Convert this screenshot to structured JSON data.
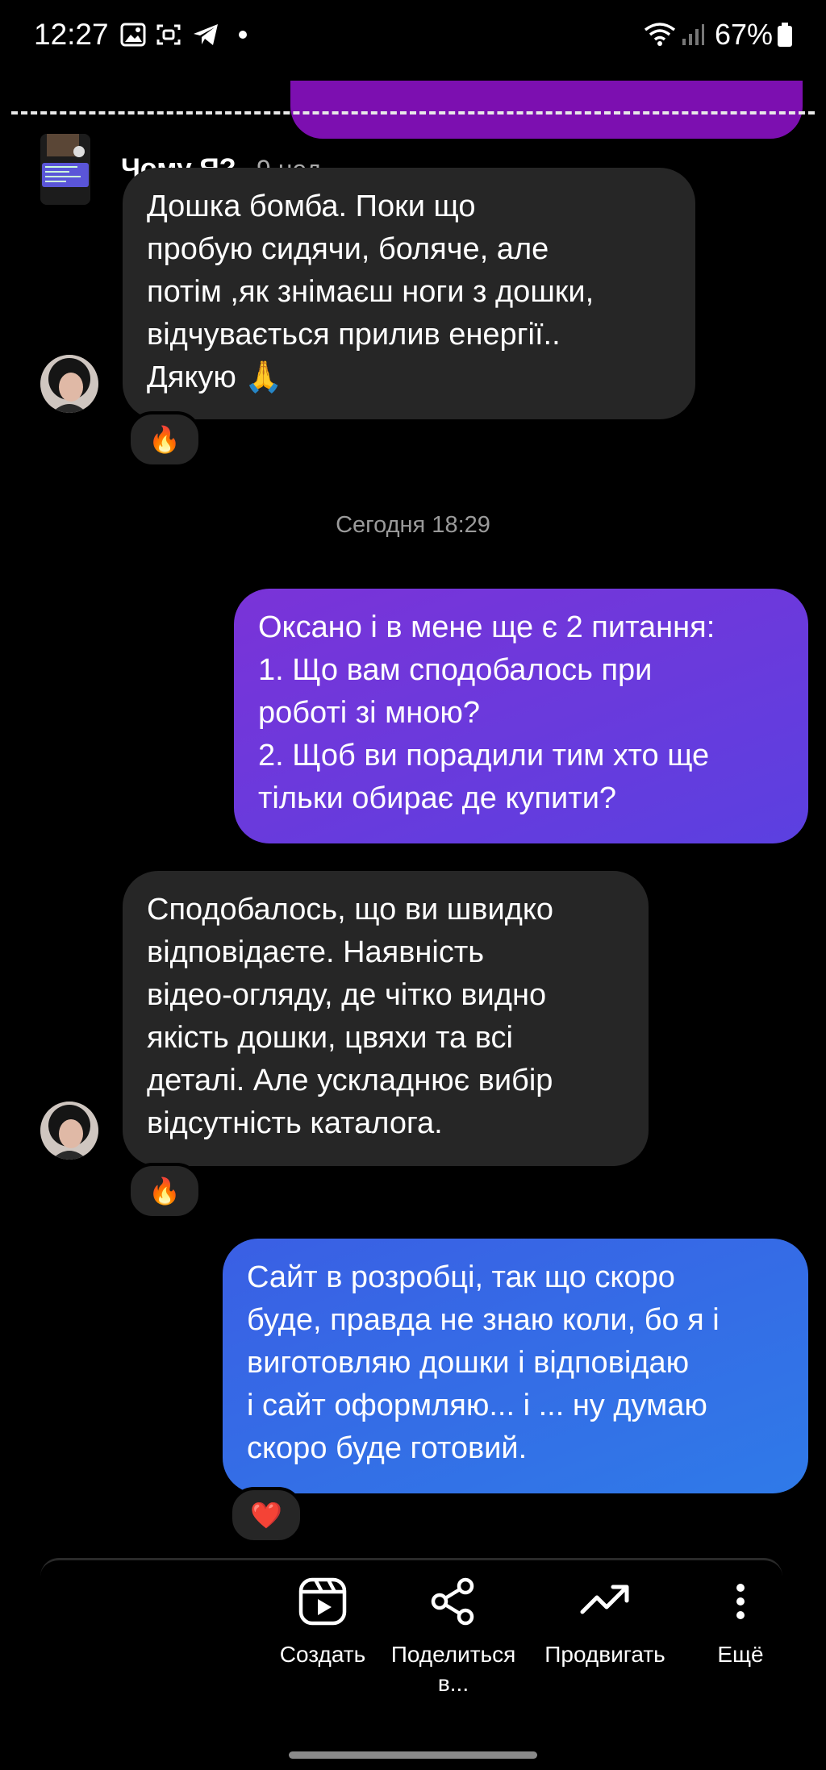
{
  "status_bar": {
    "time": "12:27",
    "battery": "67%",
    "icons": [
      "gallery-icon",
      "screen-record-icon",
      "telegram-icon",
      "dot-icon",
      "wifi-icon",
      "signal-icon",
      "battery-icon"
    ]
  },
  "reply_preview": {
    "name": "Чому Я?",
    "age": "9 нед."
  },
  "messages": [
    {
      "direction": "incoming",
      "lines": [
        "Дошка бомба. Поки що",
        "пробую сидячи, боляче, але",
        "потім ,як знімаєш ноги з дошки,",
        "відчувається прилив енергії..",
        "Дякую 🙏"
      ],
      "reaction": "🔥"
    },
    {
      "direction": "outgoing",
      "lines": [
        "Оксано і в мене ще є 2 питання:",
        "1. Що вам сподобалось при",
        "роботі зі мною?",
        "2. Щоб ви порадили тим хто ще",
        "тільки обирає де купити?"
      ]
    },
    {
      "direction": "incoming",
      "lines": [
        "Сподобалось, що ви  швидко",
        "відповідаєте. Наявність",
        "відео-огляду, де чітко видно",
        "якість дошки, цвяхи та всі",
        "деталі. Але ускладнює вибір",
        "відсутність каталога."
      ],
      "reaction": "🔥"
    },
    {
      "direction": "outgoing",
      "lines": [
        "Сайт в розробці, так що скоро",
        "буде, правда не знаю коли, бо я і",
        "виготовляю дошки і відповідаю",
        "і сайт оформляю... і ... ну думаю",
        "скоро буде готовий."
      ],
      "reaction": "❤️"
    }
  ],
  "day_separator": "Сегодня 18:29",
  "actions": [
    {
      "label": "Создать",
      "icon": "reels-icon"
    },
    {
      "label": "Поделиться в...",
      "icon": "share-icon"
    },
    {
      "label": "Продвигать",
      "icon": "trending-icon"
    },
    {
      "label": "Ещё",
      "icon": "more-vertical-icon"
    }
  ],
  "colors": {
    "background": "#000000",
    "incoming_bubble": "#262626",
    "outgoing_gradient_1": "#6e2fd6",
    "outgoing_gradient_2": "#2f6fe6",
    "top_bubble": "#7c0fb0"
  }
}
